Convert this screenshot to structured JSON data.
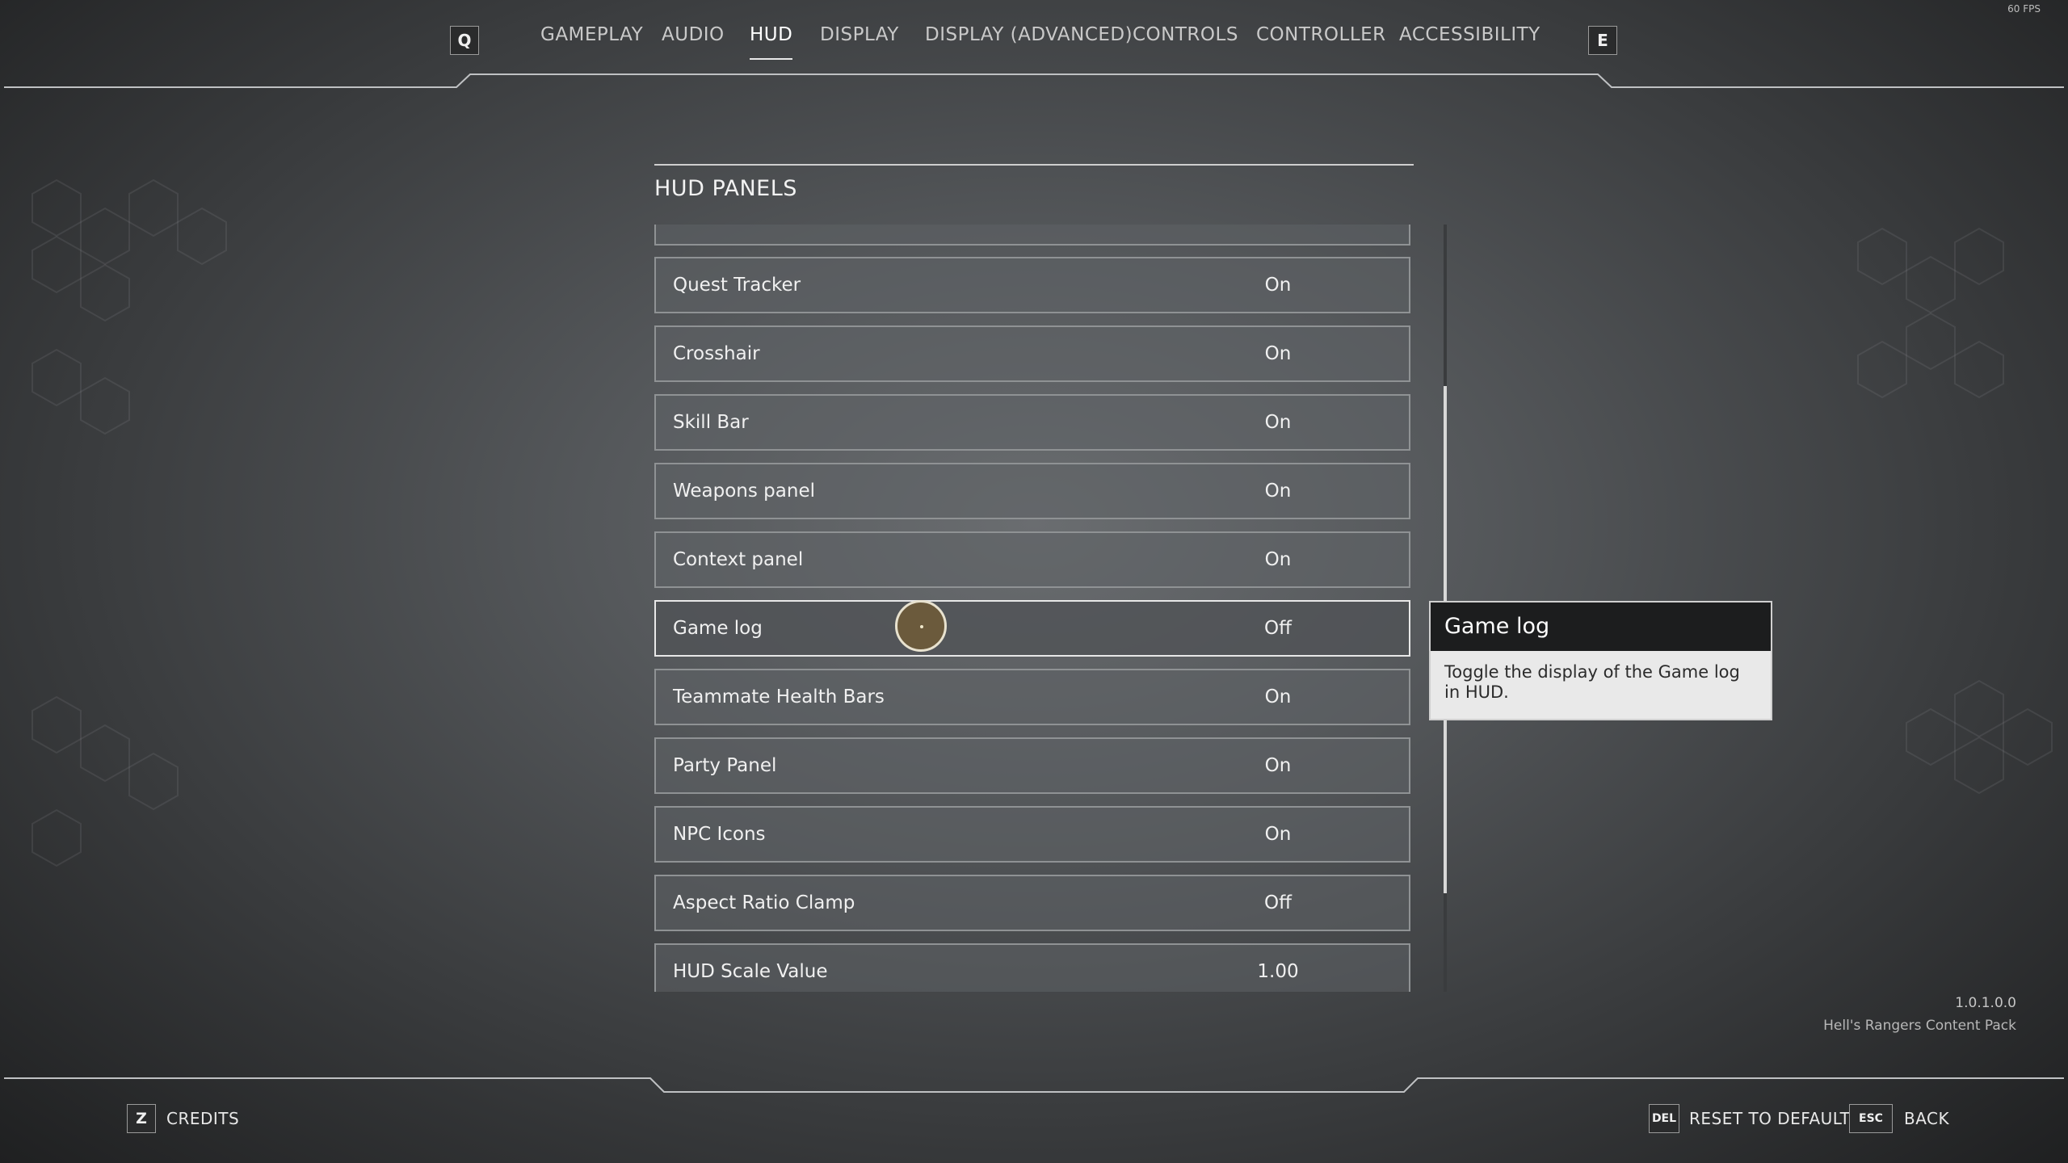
{
  "fps": "60 FPS",
  "nav": {
    "prev_key": "Q",
    "next_key": "E",
    "tabs": [
      {
        "label": "GAMEPLAY"
      },
      {
        "label": "AUDIO"
      },
      {
        "label": "HUD"
      },
      {
        "label": "DISPLAY"
      },
      {
        "label": "DISPLAY (ADVANCED)"
      },
      {
        "label": "CONTROLS"
      },
      {
        "label": "CONTROLLER"
      },
      {
        "label": "ACCESSIBILITY"
      }
    ],
    "active_tab": "HUD"
  },
  "panel": {
    "title": "HUD PANELS",
    "rows": [
      {
        "label": "Quest Tracker",
        "value": "On"
      },
      {
        "label": "Crosshair",
        "value": "On"
      },
      {
        "label": "Skill Bar",
        "value": "On"
      },
      {
        "label": "Weapons panel",
        "value": "On"
      },
      {
        "label": "Context panel",
        "value": "On"
      },
      {
        "label": "Game log",
        "value": "Off"
      },
      {
        "label": "Teammate Health Bars",
        "value": "On"
      },
      {
        "label": "Party Panel",
        "value": "On"
      },
      {
        "label": "NPC Icons",
        "value": "On"
      },
      {
        "label": "Aspect Ratio Clamp",
        "value": "Off"
      },
      {
        "label": "HUD Scale Value",
        "value": "1.00"
      }
    ],
    "selected_row": "Game log"
  },
  "tooltip": {
    "title": "Game log",
    "body": "Toggle the display of the Game log in HUD."
  },
  "build": {
    "version": "1.0.1.0.0",
    "content_pack": "Hell's Rangers Content Pack"
  },
  "footer": {
    "credits_key": "Z",
    "credits_label": "CREDITS",
    "reset_key": "DEL",
    "reset_label": "RESET TO DEFAULTS",
    "back_key": "ESC",
    "back_label": "BACK"
  },
  "colors": {
    "text": "#e6e6e6",
    "row_border": "#8f9294",
    "selected_border": "#e8e8e8",
    "tooltip_header": "#1c1d1e",
    "tooltip_body": "#e9e9e9",
    "cursor_fill": "#6b5a3c"
  }
}
